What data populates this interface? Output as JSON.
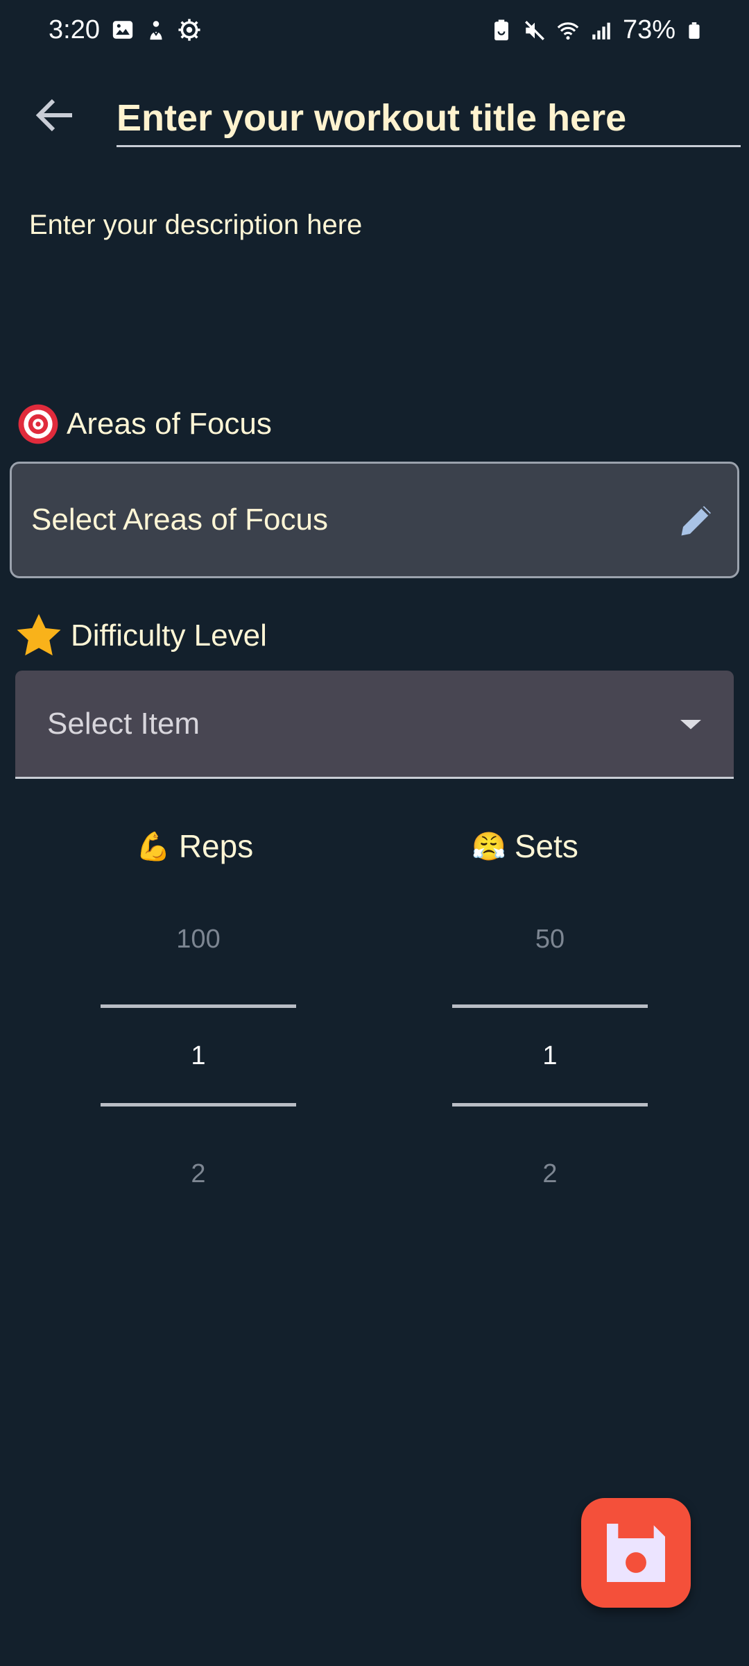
{
  "status_bar": {
    "time": "3:20",
    "battery_percent": "73%",
    "icons_left": [
      "image-icon",
      "download-icon",
      "settings-gear-icon"
    ],
    "icons_right": [
      "battery-saver-icon",
      "mute-icon",
      "wifi-icon",
      "signal-icon",
      "battery-icon"
    ]
  },
  "header": {
    "title_placeholder": "Enter your workout title here",
    "back_icon": "arrow-left-icon"
  },
  "description": {
    "placeholder": "Enter your description here"
  },
  "focus": {
    "label": "Areas of Focus",
    "icon": "target-icon",
    "select_text": "Select Areas of Focus",
    "edit_icon": "pencil-icon"
  },
  "difficulty": {
    "label": "Difficulty Level",
    "icon": "star-icon",
    "select_text": "Select Item"
  },
  "reps": {
    "emoji": "💪",
    "label": "Reps",
    "prev": "100",
    "selected": "1",
    "next": "2"
  },
  "sets": {
    "emoji": "😤",
    "label": "Sets",
    "prev": "50",
    "selected": "1",
    "next": "2"
  },
  "fab": {
    "icon": "save-icon"
  },
  "colors": {
    "background": "#13202c",
    "accent": "#f4503a",
    "title": "#fff3cf",
    "star": "#f9b21a"
  }
}
